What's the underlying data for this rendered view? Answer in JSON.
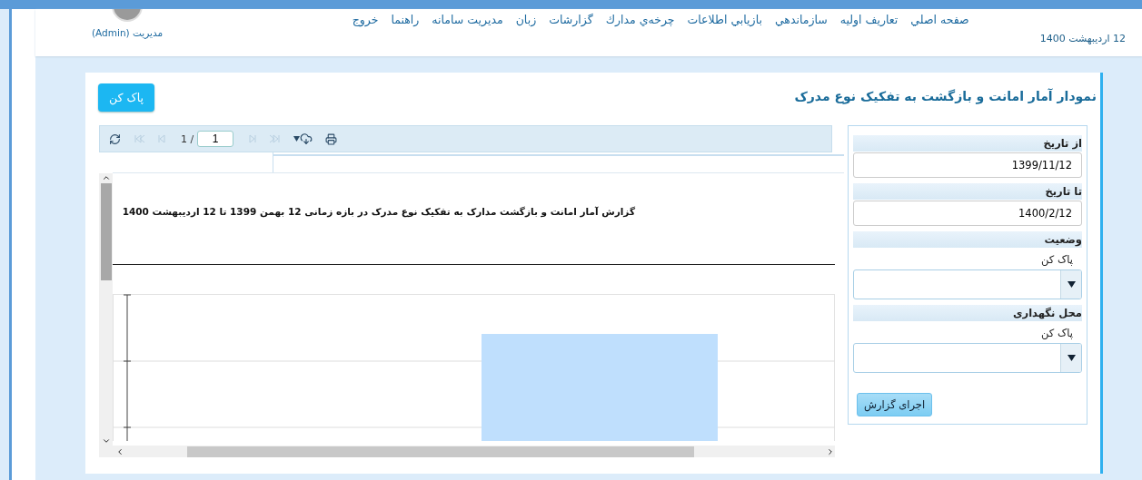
{
  "header": {
    "nav": [
      {
        "label": "صفحه اصلي"
      },
      {
        "label": "تعاريف اوليه"
      },
      {
        "label": "سازماندهي"
      },
      {
        "label": "بازيابي اطلاعات"
      },
      {
        "label": "چرخه‌ي مدارك"
      },
      {
        "label": "گزارشات"
      },
      {
        "label": "زبان"
      },
      {
        "label": "مديريت سامانه"
      },
      {
        "label": "راهنما"
      },
      {
        "label": "خروج"
      }
    ],
    "user": "مديريت (Admin)",
    "date": "12 ارديبهشت 1400"
  },
  "page": {
    "title": "نمودار آمار امانت و بازگشت به تفکیک نوع مدرک",
    "clear_button": "پاک کن"
  },
  "viewer": {
    "toolbar": {
      "buttons_before": [
        {
          "kind": "refresh",
          "disabled": false
        },
        {
          "kind": "first",
          "disabled": true
        },
        {
          "kind": "prev",
          "disabled": true
        }
      ],
      "page_label": "1 /",
      "page_input": "1",
      "buttons_after": [
        {
          "kind": "next",
          "disabled": true
        },
        {
          "kind": "last",
          "disabled": true
        },
        {
          "kind": "export",
          "disabled": false
        },
        {
          "kind": "print",
          "disabled": false
        }
      ]
    },
    "report_title": "گزارش آمار امانت و بازگشت مدارک به تفکیک نوع مدرک در بازه زمانی 12 بهمن 1399 تا 12 اردیبهشت 1400"
  },
  "filters": {
    "fields": [
      {
        "kind": "text",
        "label": "از تاریخ",
        "value": "1399/11/12"
      },
      {
        "kind": "text",
        "label": "تا تاریخ",
        "value": "1400/2/12"
      },
      {
        "kind": "select",
        "label": "وضعیت",
        "clear_link": "پاک کن"
      },
      {
        "kind": "select",
        "label": "محل نگهداری",
        "clear_link": "پاک کن"
      }
    ],
    "run_button": "اجرای گزارش"
  }
}
